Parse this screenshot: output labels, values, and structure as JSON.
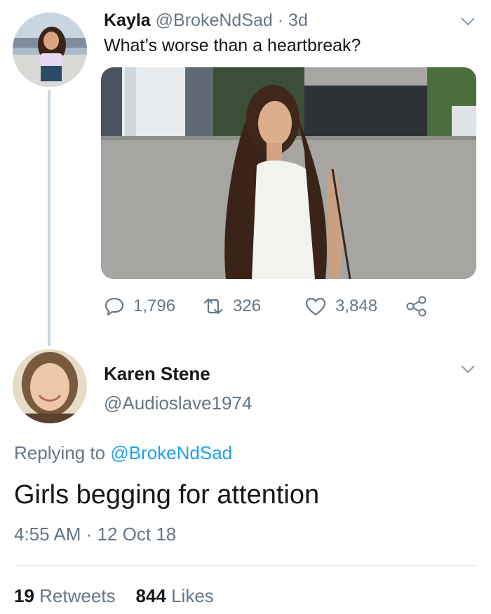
{
  "tweet": {
    "author_name": "Kayla",
    "author_handle": "@BrokeNdSad",
    "age": "3d",
    "text": "What’s worse than a heartbreak?",
    "actions": {
      "replies": "1,796",
      "retweets": "326",
      "likes": "3,848"
    }
  },
  "reply": {
    "author_name": "Karen Stene",
    "author_handle": "@Audioslave1974",
    "replying_prefix": "Replying to",
    "replying_handle": "@BrokeNdSad",
    "text": "Girls begging for attention",
    "timestamp": "4:55 AM · 12 Oct 18",
    "retweets_count": "19",
    "retweets_label": "Retweets",
    "likes_count": "844",
    "likes_label": "Likes"
  },
  "colors": {
    "link": "#1da1f2",
    "muted": "#657786",
    "thread_line": "#ccd6dd"
  }
}
